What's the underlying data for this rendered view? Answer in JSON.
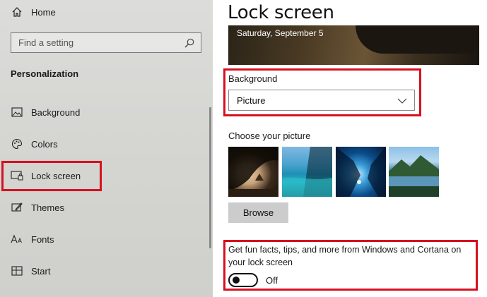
{
  "sidebar": {
    "home_label": "Home",
    "search_placeholder": "Find a setting",
    "section_heading": "Personalization",
    "items": [
      {
        "label": "Background",
        "icon": "picture-icon"
      },
      {
        "label": "Colors",
        "icon": "palette-icon"
      },
      {
        "label": "Lock screen",
        "icon": "lock-screen-icon",
        "selected": true
      },
      {
        "label": "Themes",
        "icon": "themes-icon"
      },
      {
        "label": "Fonts",
        "icon": "fonts-icon"
      },
      {
        "label": "Start",
        "icon": "start-icon"
      }
    ]
  },
  "main": {
    "title": "Lock screen",
    "preview_date": "Saturday, September 5",
    "background": {
      "label": "Background",
      "selected_value": "Picture"
    },
    "choose_picture_label": "Choose your picture",
    "browse_label": "Browse",
    "fun_facts": {
      "text": "Get fun facts, tips, and more from Windows and Cortana on your lock screen",
      "state": "Off"
    }
  },
  "colors": {
    "highlight": "#d6101f",
    "sidebar_bg": "#d8d8d5"
  }
}
